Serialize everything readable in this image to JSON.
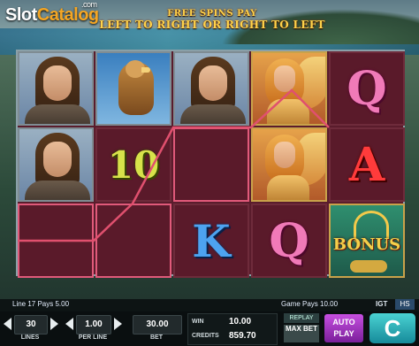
{
  "logo": {
    "slot": "Slot",
    "catalog": "Catalog",
    "suffix": ".com"
  },
  "banner": {
    "line1": "FREE SPINS PAY",
    "line2": "LEFT TO RIGHT OR RIGHT TO LEFT"
  },
  "reels": {
    "symbols": {
      "q": "Q",
      "k": "K",
      "a": "A",
      "ten": "10",
      "bonus": "BONUS"
    }
  },
  "info": {
    "line_win": "Line 17 Pays 5.00",
    "game_pays": "Game Pays 10.00",
    "igt": "IGT",
    "hs": "HS"
  },
  "controls": {
    "lines_value": "30",
    "lines_label": "LINES",
    "per_line_value": "1.00",
    "per_line_label": "PER LINE",
    "bet_value": "30.00",
    "bet_label": "BET",
    "win_label": "WIN",
    "win_value": "10.00",
    "credits_label": "CREDITS",
    "credits_value": "859.70",
    "replay_label": "REPLAY",
    "maxbet_label": "MAX BET",
    "autoplay_label": "AUTO PLAY",
    "spin_icon": "C"
  },
  "colors": {
    "payline": "#e0506e",
    "reel_bg": "#5a1c2c",
    "autoplay": "#b040d0",
    "spin": "#2ab0c0"
  }
}
